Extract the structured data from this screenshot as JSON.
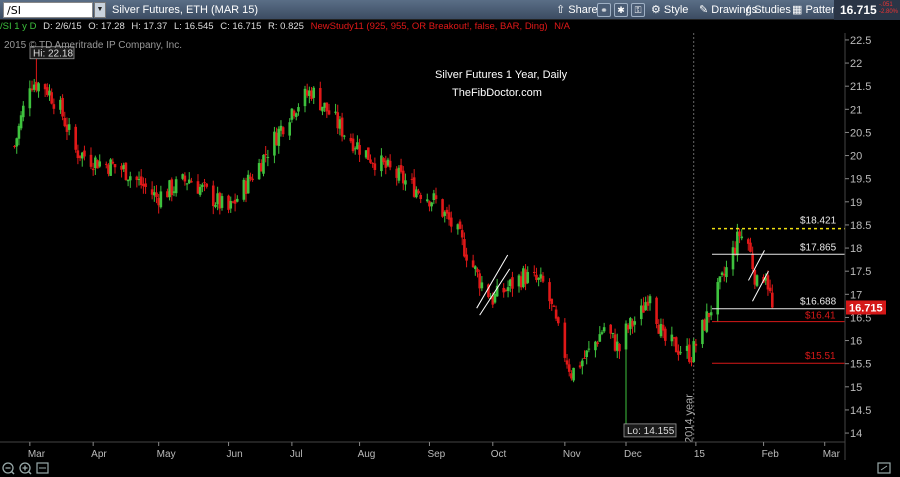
{
  "toolbar": {
    "symbol": "/SI",
    "instrument": "Silver Futures, ETH (MAR 15)",
    "share_label": "Share",
    "style_label": "Style",
    "drawings_label": "Drawings",
    "studies_label": "Studies",
    "patterns_label": "Patterns",
    "last_price": "16.715",
    "change_top": "-.051",
    "change_bottom": "-2.80%"
  },
  "infobar": {
    "symbol_period": "/SI 1 y D",
    "date": "D: 2/6/15",
    "open": "O: 17.28",
    "high": "H: 17.37",
    "low": "L: 16.545",
    "close": "C: 16.715",
    "range": "R: 0.825",
    "study": "NewStudy11 (925, 955, OR Breakout!, false, BAR, Ding)",
    "na": "N/A"
  },
  "chart_overlay": {
    "copyright": "2015 © TD Ameritrade IP Company, Inc.",
    "hi_label": "Hi: 22.18",
    "lo_label": "Lo: 14.155",
    "title_line1": "Silver Futures 1 Year, Daily",
    "title_line2": "TheFibDoctor.com",
    "year_marker": "2014 year",
    "level_18421": "$18.421",
    "level_17865": "$17.865",
    "level_16688": "$16.688",
    "level_1641": "$16.41",
    "level_1551": "$15.51",
    "price_tag": "16.715"
  },
  "colors": {
    "up": "#3ec23e",
    "down": "#e01818",
    "accent_yellow": "#f0e010",
    "level_red": "#d81818",
    "level_white": "#e8e8e8"
  },
  "chart_data": {
    "type": "candlestick",
    "title": "Silver Futures 1 Year, Daily",
    "subtitle": "TheFibDoctor.com",
    "x_tick_labels": [
      "Mar",
      "Apr",
      "May",
      "Jun",
      "Jul",
      "Aug",
      "Sep",
      "Oct",
      "Nov",
      "Dec",
      "15",
      "Feb",
      "Mar"
    ],
    "y_tick_labels": [
      "14",
      "14.5",
      "15",
      "15.5",
      "16",
      "16.5",
      "17",
      "17.5",
      "18",
      "18.5",
      "19",
      "19.5",
      "20",
      "20.5",
      "21",
      "21.5",
      "22",
      "22.5"
    ],
    "ylim": [
      13.85,
      22.65
    ],
    "hi": 22.18,
    "lo": 14.155,
    "levels": [
      18.421,
      17.865,
      16.688,
      16.41,
      15.51
    ],
    "last": 16.715,
    "anchors": [
      [
        "2014-02-24",
        20.2
      ],
      [
        "2014-03-03",
        21.6
      ],
      [
        "2014-03-10",
        21.5
      ],
      [
        "2014-03-17",
        21.0
      ],
      [
        "2014-03-24",
        20.1
      ],
      [
        "2014-04-01",
        19.9
      ],
      [
        "2014-04-15",
        19.7
      ],
      [
        "2014-04-30",
        19.1
      ],
      [
        "2014-05-15",
        19.5
      ],
      [
        "2014-06-02",
        18.8
      ],
      [
        "2014-06-16",
        19.8
      ],
      [
        "2014-07-01",
        21.0
      ],
      [
        "2014-07-10",
        21.4
      ],
      [
        "2014-07-25",
        20.5
      ],
      [
        "2014-08-05",
        20.0
      ],
      [
        "2014-08-20",
        19.5
      ],
      [
        "2014-09-05",
        19.0
      ],
      [
        "2014-09-15",
        18.3
      ],
      [
        "2014-09-25",
        17.3
      ],
      [
        "2014-10-01",
        16.9
      ],
      [
        "2014-10-15",
        17.4
      ],
      [
        "2014-10-25",
        17.2
      ],
      [
        "2014-11-01",
        16.0
      ],
      [
        "2014-11-06",
        15.3
      ],
      [
        "2014-11-15",
        15.8
      ],
      [
        "2014-11-21",
        16.3
      ],
      [
        "2014-11-28",
        15.8
      ],
      [
        "2014-12-01",
        16.2
      ],
      [
        "2014-12-08",
        16.6
      ],
      [
        "2014-12-12",
        17.1
      ],
      [
        "2014-12-18",
        16.0
      ],
      [
        "2014-12-31",
        15.7
      ],
      [
        "2015-01-08",
        16.6
      ],
      [
        "2015-01-15",
        17.4
      ],
      [
        "2015-01-22",
        18.3
      ],
      [
        "2015-01-26",
        18.1
      ],
      [
        "2015-01-30",
        17.2
      ],
      [
        "2015-02-03",
        17.5
      ],
      [
        "2015-02-06",
        16.715
      ]
    ]
  }
}
